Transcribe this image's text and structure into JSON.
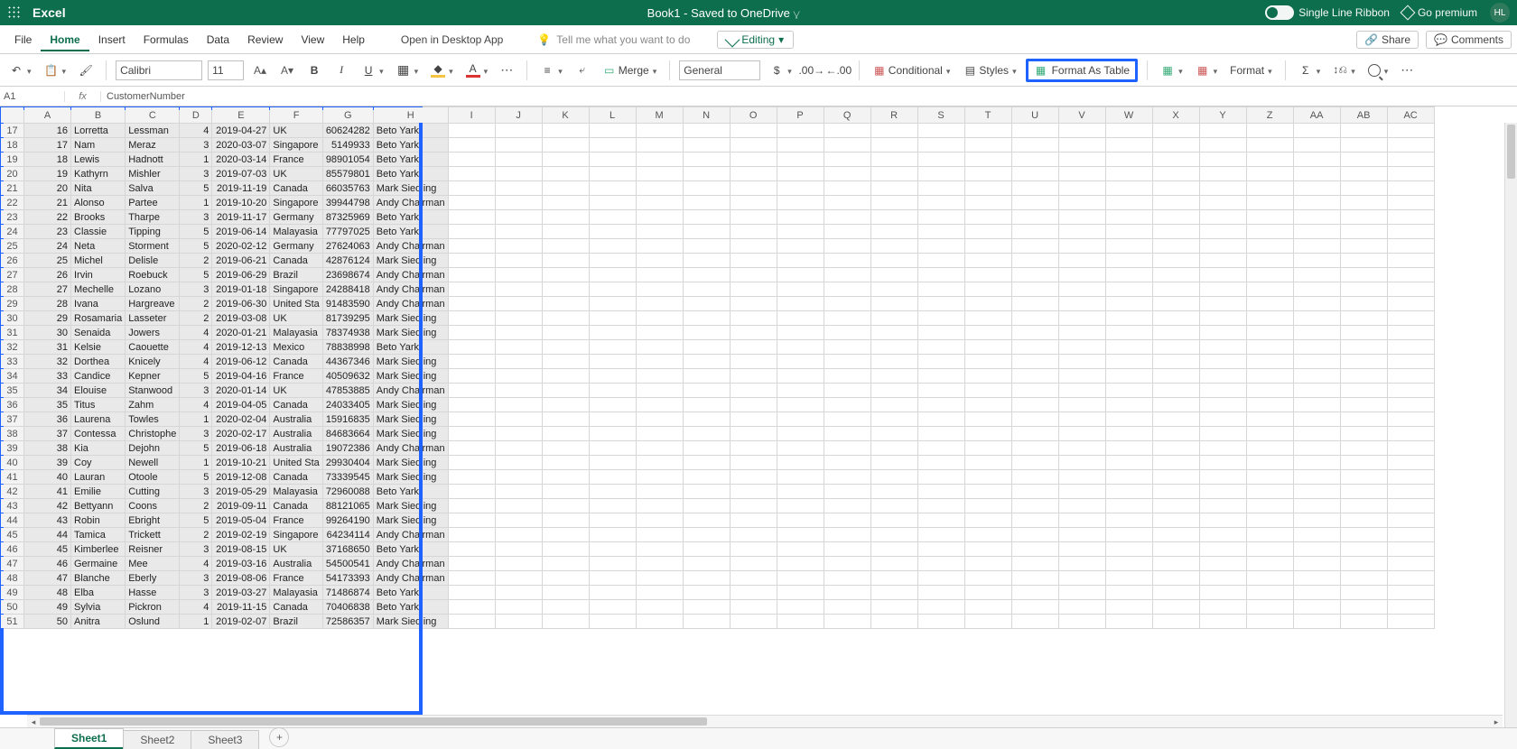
{
  "titlebar": {
    "app": "Excel",
    "doc": "Book1  -  Saved to OneDrive",
    "single_line": "Single Line Ribbon",
    "premium": "Go premium",
    "initials": "HL"
  },
  "tabs": {
    "items": [
      "File",
      "Home",
      "Insert",
      "Formulas",
      "Data",
      "Review",
      "View",
      "Help"
    ],
    "active": "Home",
    "open_desktop": "Open in Desktop App",
    "tell_me": "Tell me what you want to do",
    "editing": "Editing",
    "share": "Share",
    "comments": "Comments"
  },
  "ribbon": {
    "font": "Calibri",
    "size": "11",
    "number_format": "General",
    "merge": "Merge",
    "conditional": "Conditional",
    "styles": "Styles",
    "format_as_table": "Format As Table",
    "format": "Format"
  },
  "namebox": {
    "cell": "A1",
    "formula": "CustomerNumber"
  },
  "columns": [
    "A",
    "B",
    "C",
    "D",
    "E",
    "F",
    "G",
    "H",
    "I",
    "J",
    "K",
    "L",
    "M",
    "N",
    "O",
    "P",
    "Q",
    "R",
    "S",
    "T",
    "U",
    "V",
    "W",
    "X",
    "Y",
    "Z",
    "AA",
    "AB",
    "AC"
  ],
  "row_start": 17,
  "rows": [
    {
      "n": 17,
      "a": 16,
      "b": "Lorretta",
      "c": "Lessman",
      "d": 4,
      "e": "2019-04-27",
      "f": "UK",
      "g": "60624282",
      "h": "Beto Yark"
    },
    {
      "n": 18,
      "a": 17,
      "b": "Nam",
      "c": "Meraz",
      "d": 3,
      "e": "2020-03-07",
      "f": "Singapore",
      "g": "5149933",
      "h": "Beto Yark"
    },
    {
      "n": 19,
      "a": 18,
      "b": "Lewis",
      "c": "Hadnott",
      "d": 1,
      "e": "2020-03-14",
      "f": "France",
      "g": "98901054",
      "h": "Beto Yark"
    },
    {
      "n": 20,
      "a": 19,
      "b": "Kathyrn",
      "c": "Mishler",
      "d": 3,
      "e": "2019-07-03",
      "f": "UK",
      "g": "85579801",
      "h": "Beto Yark"
    },
    {
      "n": 21,
      "a": 20,
      "b": "Nita",
      "c": "Salva",
      "d": 5,
      "e": "2019-11-19",
      "f": "Canada",
      "g": "66035763",
      "h": "Mark Siedling"
    },
    {
      "n": 22,
      "a": 21,
      "b": "Alonso",
      "c": "Partee",
      "d": 1,
      "e": "2019-10-20",
      "f": "Singapore",
      "g": "39944798",
      "h": "Andy Chairman"
    },
    {
      "n": 23,
      "a": 22,
      "b": "Brooks",
      "c": "Tharpe",
      "d": 3,
      "e": "2019-11-17",
      "f": "Germany",
      "g": "87325969",
      "h": "Beto Yark"
    },
    {
      "n": 24,
      "a": 23,
      "b": "Classie",
      "c": "Tipping",
      "d": 5,
      "e": "2019-06-14",
      "f": "Malayasia",
      "g": "77797025",
      "h": "Beto Yark"
    },
    {
      "n": 25,
      "a": 24,
      "b": "Neta",
      "c": "Storment",
      "d": 5,
      "e": "2020-02-12",
      "f": "Germany",
      "g": "27624063",
      "h": "Andy Chairman"
    },
    {
      "n": 26,
      "a": 25,
      "b": "Michel",
      "c": "Delisle",
      "d": 2,
      "e": "2019-06-21",
      "f": "Canada",
      "g": "42876124",
      "h": "Mark Siedling"
    },
    {
      "n": 27,
      "a": 26,
      "b": "Irvin",
      "c": "Roebuck",
      "d": 5,
      "e": "2019-06-29",
      "f": "Brazil",
      "g": "23698674",
      "h": "Andy Chairman"
    },
    {
      "n": 28,
      "a": 27,
      "b": "Mechelle",
      "c": "Lozano",
      "d": 3,
      "e": "2019-01-18",
      "f": "Singapore",
      "g": "24288418",
      "h": "Andy Chairman"
    },
    {
      "n": 29,
      "a": 28,
      "b": "Ivana",
      "c": "Hargreave",
      "d": 2,
      "e": "2019-06-30",
      "f": "United Sta",
      "g": "91483590",
      "h": "Andy Chairman"
    },
    {
      "n": 30,
      "a": 29,
      "b": "Rosamaria",
      "c": "Lasseter",
      "d": 2,
      "e": "2019-03-08",
      "f": "UK",
      "g": "81739295",
      "h": "Mark Siedling"
    },
    {
      "n": 31,
      "a": 30,
      "b": "Senaida",
      "c": "Jowers",
      "d": 4,
      "e": "2020-01-21",
      "f": "Malayasia",
      "g": "78374938",
      "h": "Mark Siedling"
    },
    {
      "n": 32,
      "a": 31,
      "b": "Kelsie",
      "c": "Caouette",
      "d": 4,
      "e": "2019-12-13",
      "f": "Mexico",
      "g": "78838998",
      "h": "Beto Yark"
    },
    {
      "n": 33,
      "a": 32,
      "b": "Dorthea",
      "c": "Knicely",
      "d": 4,
      "e": "2019-06-12",
      "f": "Canada",
      "g": "44367346",
      "h": "Mark Siedling"
    },
    {
      "n": 34,
      "a": 33,
      "b": "Candice",
      "c": "Kepner",
      "d": 5,
      "e": "2019-04-16",
      "f": "France",
      "g": "40509632",
      "h": "Mark Siedling"
    },
    {
      "n": 35,
      "a": 34,
      "b": "Elouise",
      "c": "Stanwood",
      "d": 3,
      "e": "2020-01-14",
      "f": "UK",
      "g": "47853885",
      "h": "Andy Chairman"
    },
    {
      "n": 36,
      "a": 35,
      "b": "Titus",
      "c": "Zahm",
      "d": 4,
      "e": "2019-04-05",
      "f": "Canada",
      "g": "24033405",
      "h": "Mark Siedling"
    },
    {
      "n": 37,
      "a": 36,
      "b": "Laurena",
      "c": "Towles",
      "d": 1,
      "e": "2020-02-04",
      "f": "Australia",
      "g": "15916835",
      "h": "Mark Siedling"
    },
    {
      "n": 38,
      "a": 37,
      "b": "Contessa",
      "c": "Christophe",
      "d": 3,
      "e": "2020-02-17",
      "f": "Australia",
      "g": "84683664",
      "h": "Mark Siedling"
    },
    {
      "n": 39,
      "a": 38,
      "b": "Kia",
      "c": "Dejohn",
      "d": 5,
      "e": "2019-06-18",
      "f": "Australia",
      "g": "19072386",
      "h": "Andy Chairman"
    },
    {
      "n": 40,
      "a": 39,
      "b": "Coy",
      "c": "Newell",
      "d": 1,
      "e": "2019-10-21",
      "f": "United Sta",
      "g": "29930404",
      "h": "Mark Siedling"
    },
    {
      "n": 41,
      "a": 40,
      "b": "Lauran",
      "c": "Otoole",
      "d": 5,
      "e": "2019-12-08",
      "f": "Canada",
      "g": "73339545",
      "h": "Mark Siedling"
    },
    {
      "n": 42,
      "a": 41,
      "b": "Emilie",
      "c": "Cutting",
      "d": 3,
      "e": "2019-05-29",
      "f": "Malayasia",
      "g": "72960088",
      "h": "Beto Yark"
    },
    {
      "n": 43,
      "a": 42,
      "b": "Bettyann",
      "c": "Coons",
      "d": 2,
      "e": "2019-09-11",
      "f": "Canada",
      "g": "88121065",
      "h": "Mark Siedling"
    },
    {
      "n": 44,
      "a": 43,
      "b": "Robin",
      "c": "Ebright",
      "d": 5,
      "e": "2019-05-04",
      "f": "France",
      "g": "99264190",
      "h": "Mark Siedling"
    },
    {
      "n": 45,
      "a": 44,
      "b": "Tamica",
      "c": "Trickett",
      "d": 2,
      "e": "2019-02-19",
      "f": "Singapore",
      "g": "64234114",
      "h": "Andy Chairman"
    },
    {
      "n": 46,
      "a": 45,
      "b": "Kimberlee",
      "c": "Reisner",
      "d": 3,
      "e": "2019-08-15",
      "f": "UK",
      "g": "37168650",
      "h": "Beto Yark"
    },
    {
      "n": 47,
      "a": 46,
      "b": "Germaine",
      "c": "Mee",
      "d": 4,
      "e": "2019-03-16",
      "f": "Australia",
      "g": "54500541",
      "h": "Andy Chairman"
    },
    {
      "n": 48,
      "a": 47,
      "b": "Blanche",
      "c": "Eberly",
      "d": 3,
      "e": "2019-08-06",
      "f": "France",
      "g": "54173393",
      "h": "Andy Chairman"
    },
    {
      "n": 49,
      "a": 48,
      "b": "Elba",
      "c": "Hasse",
      "d": 3,
      "e": "2019-03-27",
      "f": "Malayasia",
      "g": "71486874",
      "h": "Beto Yark"
    },
    {
      "n": 50,
      "a": 49,
      "b": "Sylvia",
      "c": "Pickron",
      "d": 4,
      "e": "2019-11-15",
      "f": "Canada",
      "g": "70406838",
      "h": "Beto Yark"
    },
    {
      "n": 51,
      "a": 50,
      "b": "Anitra",
      "c": "Oslund",
      "d": 1,
      "e": "2019-02-07",
      "f": "Brazil",
      "g": "72586357",
      "h": "Mark Siedling"
    }
  ],
  "sheets": [
    "Sheet1",
    "Sheet2",
    "Sheet3"
  ],
  "active_sheet": "Sheet1"
}
